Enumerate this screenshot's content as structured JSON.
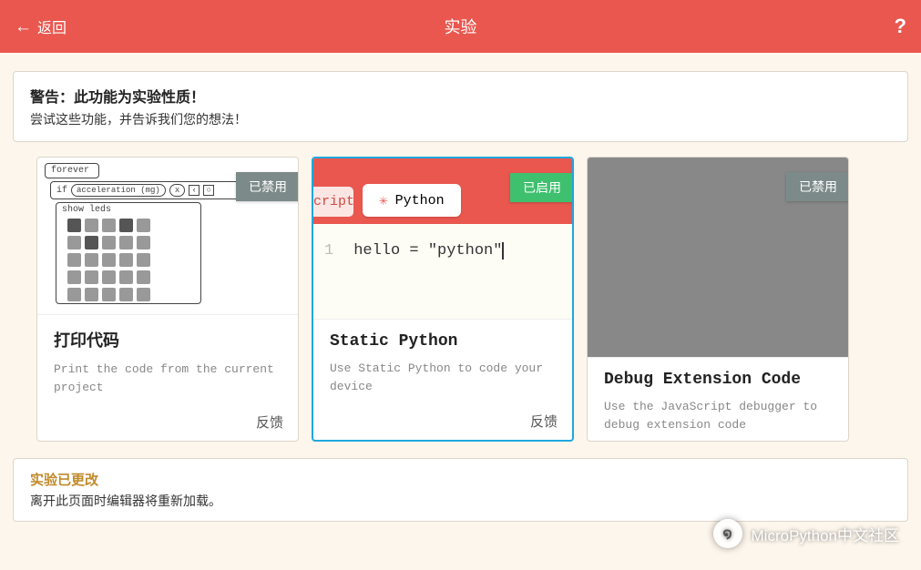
{
  "header": {
    "back_label": "返回",
    "title": "实验",
    "help_label": "?"
  },
  "warning": {
    "title": "警告：此功能为实验性质！",
    "text": "尝试这些功能，并告诉我们您的想法！"
  },
  "status_labels": {
    "disabled": "已禁用",
    "enabled": "已启用"
  },
  "cards": [
    {
      "title": "打印代码",
      "desc": "Print the code from the current project",
      "status": "disabled",
      "feedback_label": "反馈",
      "preview": {
        "forever": "forever",
        "if": "if",
        "accel": "acceleration (mg)",
        "x": "x",
        "show_leds": "show leds"
      }
    },
    {
      "title": "Static Python",
      "desc": "Use Static Python to code your device",
      "status": "enabled",
      "feedback_label": "反馈",
      "preview": {
        "cut_tab": "cript",
        "tab_label": "Python",
        "line_no": "1",
        "code": "hello = \"python\""
      }
    },
    {
      "title": "Debug Extension Code",
      "desc": "Use the JavaScript debugger to debug extension code",
      "status": "disabled"
    }
  ],
  "changed": {
    "title": "实验已更改",
    "text": "离开此页面时编辑器将重新加载。"
  },
  "watermark": {
    "text": "MicroPython中文社区"
  }
}
